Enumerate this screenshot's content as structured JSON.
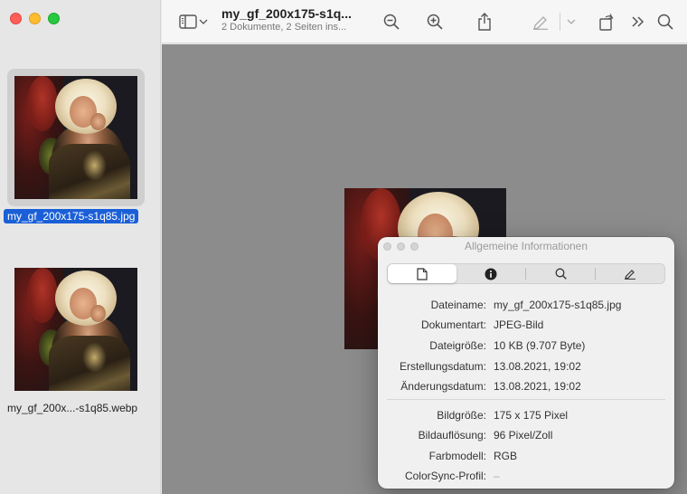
{
  "sidebar": {
    "thumbnails": [
      {
        "filename": "my_gf_200x175-s1q85.jpg",
        "selected": true
      },
      {
        "filename": "my_gf_200x...-s1q85.webp",
        "selected": false
      }
    ]
  },
  "toolbar": {
    "title": "my_gf_200x175-s1q...",
    "subtitle": "2 Dokumente, 2 Seiten ins...",
    "icons": [
      "sidebar-toggle-icon",
      "chevron-down-icon",
      "zoom-out-icon",
      "zoom-in-icon",
      "share-icon",
      "markup-icon",
      "chevron-down-icon",
      "rotate-icon",
      "more-icon",
      "search-icon"
    ]
  },
  "info_panel": {
    "title": "Allgemeine Informationen",
    "tabs": [
      "document-icon",
      "info-icon",
      "search-icon",
      "pen-icon"
    ],
    "general": [
      {
        "label": "Dateiname:",
        "value": "my_gf_200x175-s1q85.jpg"
      },
      {
        "label": "Dokumentart:",
        "value": "JPEG-Bild"
      },
      {
        "label": "Dateigröße:",
        "value": "10 KB (9.707 Byte)"
      },
      {
        "label": "Erstellungsdatum:",
        "value": "13.08.2021, 19:02"
      },
      {
        "label": "Änderungsdatum:",
        "value": "13.08.2021, 19:02"
      }
    ],
    "image": [
      {
        "label": "Bildgröße:",
        "value": "175 x 175 Pixel"
      },
      {
        "label": "Bildauflösung:",
        "value": "96 Pixel/Zoll"
      },
      {
        "label": "Farbmodell:",
        "value": "RGB"
      },
      {
        "label": "ColorSync-Profil:",
        "value": "–"
      }
    ]
  },
  "colors": {
    "selection": "#1a5fd7",
    "canvas": "#8c8c8c"
  }
}
